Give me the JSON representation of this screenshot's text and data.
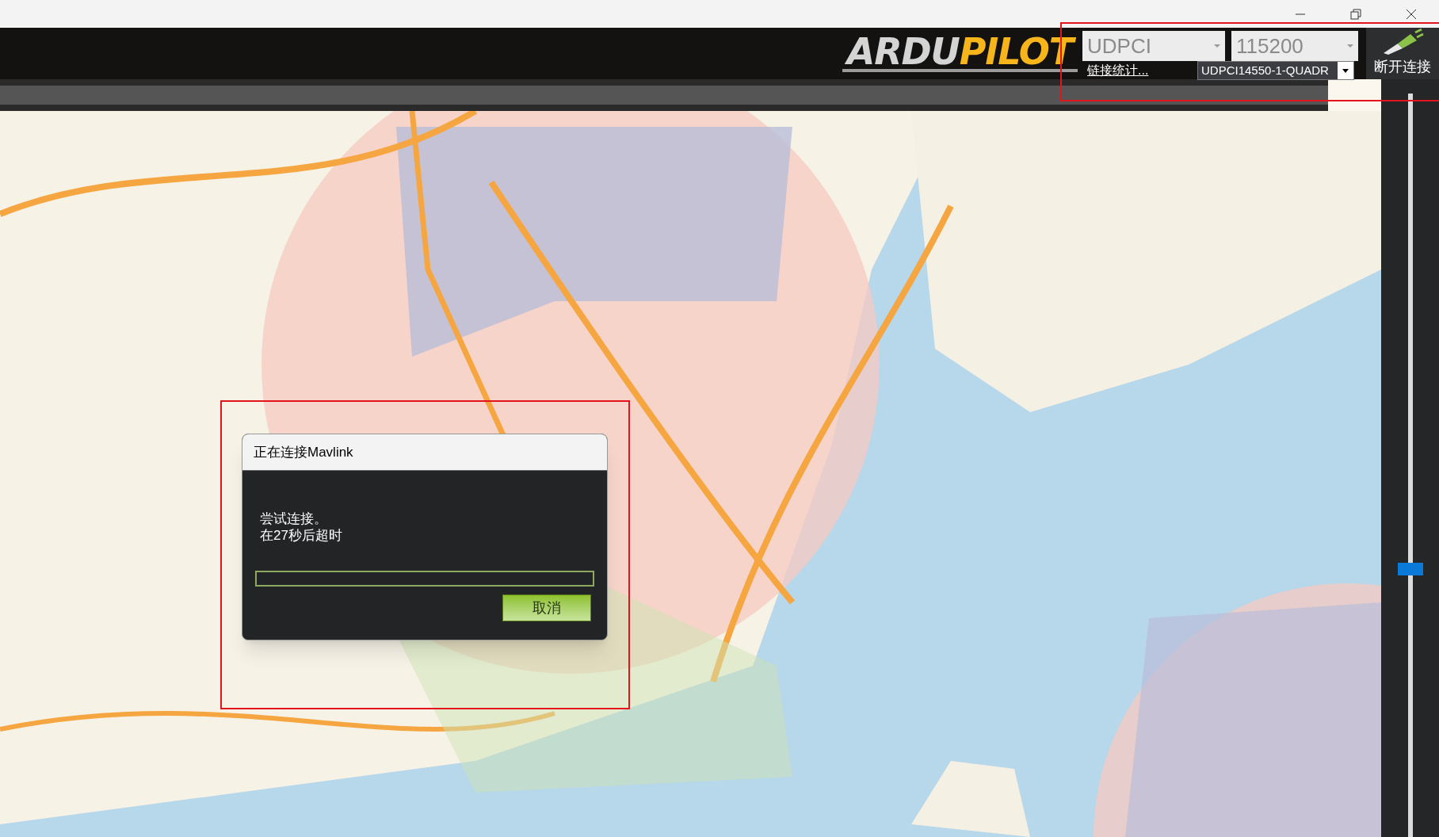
{
  "toolbar": {
    "logo_parts": [
      "ARDU",
      "PILOT"
    ],
    "connection_type": "UDPCI",
    "baud_rate": "115200",
    "link_stats": "链接统计...",
    "vehicle": "UDPCI14550-1-QUADR",
    "disconnect": "断开连接"
  },
  "zoom_slider": {
    "level": 0.36
  },
  "dialog": {
    "title": "正在连接Mavlink",
    "message_lines": [
      "尝试连接。",
      "在27秒后超时"
    ],
    "progress": {
      "level": 0
    },
    "cancel": "取消"
  },
  "highlights": {
    "around_toolbar": true,
    "around_dialog": true
  }
}
